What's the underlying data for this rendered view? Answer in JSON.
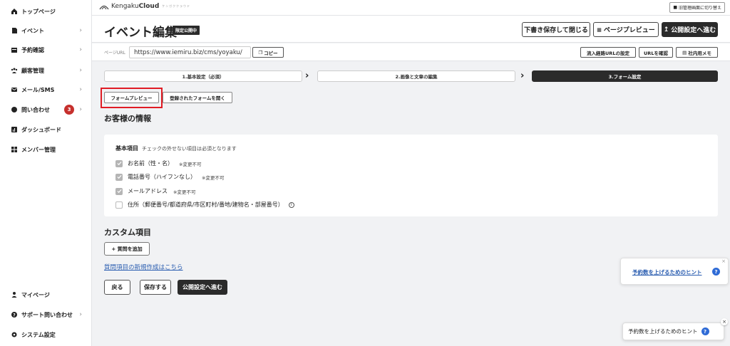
{
  "sidebar": {
    "items": [
      {
        "label": "トップページ",
        "icon": "home-icon",
        "chevron": false
      },
      {
        "label": "イベント",
        "icon": "document-icon",
        "chevron": true
      },
      {
        "label": "予約確認",
        "icon": "calendar-icon",
        "chevron": true
      },
      {
        "label": "顧客管理",
        "icon": "people-icon",
        "chevron": true
      },
      {
        "label": "メール/SMS",
        "icon": "mail-icon",
        "chevron": true
      },
      {
        "label": "問い合わせ",
        "icon": "chat-icon",
        "chevron": true,
        "badge": "3"
      },
      {
        "label": "ダッシュボード",
        "icon": "chart-icon",
        "chevron": false
      },
      {
        "label": "メンバー管理",
        "icon": "grid-icon",
        "chevron": false
      }
    ],
    "bottom_items": [
      {
        "label": "マイページ",
        "icon": "person-icon",
        "chevron": false
      },
      {
        "label": "サポート問い合わせ",
        "icon": "help-icon",
        "chevron": true
      },
      {
        "label": "システム設定",
        "icon": "gear-icon",
        "chevron": false
      }
    ],
    "chevron": "›"
  },
  "header": {
    "logo_text_a": "Kengaku",
    "logo_text_b": "Cloud",
    "logo_tagline": "ケンガククラウド",
    "old_admin_button": "旧管理画面に切り替え"
  },
  "title_bar": {
    "title": "イベント編集",
    "badge": "限定公開中",
    "save_close": "下書き保存して閉じる",
    "preview": "ページプレビュー",
    "publish": "公開設定へ進む"
  },
  "url_bar": {
    "label": "ページURL",
    "url": "https://www.iemiru.biz/cms/yoyaku/",
    "copy": "コピー",
    "route_url": "流入経路URLの設定",
    "check_url": "URLを確認",
    "memo": "社内用メモ"
  },
  "steps": [
    {
      "label": "1.基本設定（必須）",
      "active": false
    },
    {
      "label": "2.画像と文章の編集",
      "active": false
    },
    {
      "label": "3.フォーム設定",
      "active": true
    }
  ],
  "form_tabs": {
    "preview": "フォームプレビュー",
    "open_registered": "登録されたフォームを開く"
  },
  "customer_info": {
    "title": "お客様の情報",
    "basic_title": "基本項目",
    "basic_note": "チェックの外せない項目は必須となります",
    "fields": [
      {
        "label": "お名前（性・名）",
        "note": "※変更不可",
        "checked": true
      },
      {
        "label": "電話番号（ハイフンなし）",
        "note": "※変更不可",
        "checked": true
      },
      {
        "label": "メールアドレス",
        "note": "※変更不可",
        "checked": true
      },
      {
        "label": "住所（郵便番号/都道府県/市区町村/番地/建物名・部屋番号）",
        "note": "",
        "checked": false
      }
    ]
  },
  "custom_items": {
    "title": "カスタム項目",
    "add_question": "+ 質問を追加",
    "new_link": "質問項目の新規作成はこちら"
  },
  "footer_buttons": {
    "back": "戻る",
    "save": "保存する",
    "publish": "公開設定へ進む"
  },
  "hints": {
    "hint_link": "予約数を上げるためのヒント",
    "hint_button": "予約数を上げるためのヒント",
    "close": "×",
    "question": "?"
  },
  "colors": {
    "accent_dark": "#2b2b2b",
    "highlight_red": "#e01c24",
    "link_blue": "#2a5db0",
    "badge_red": "#c6302d"
  }
}
